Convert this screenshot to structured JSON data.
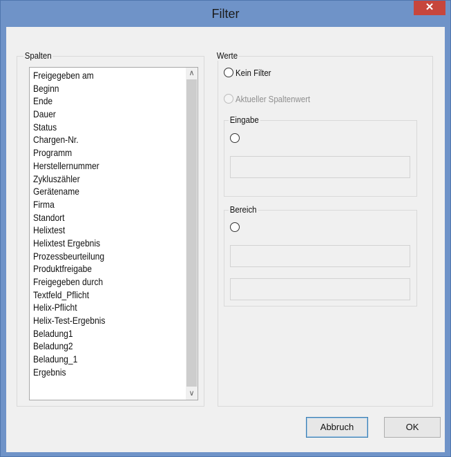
{
  "window": {
    "title": "Filter",
    "close_glyph": "✕"
  },
  "columns_group": {
    "label": "Spalten",
    "items": [
      "Freigegeben am",
      "Beginn",
      "Ende",
      "Dauer",
      "Status",
      "Chargen-Nr.",
      "Programm",
      "Herstellernummer",
      "Zykluszähler",
      "Gerätename",
      "Firma",
      "Standort",
      "Helixtest",
      "Helixtest Ergebnis",
      "Prozessbeurteilung",
      "Produktfreigabe",
      "Freigegeben durch",
      "Textfeld_Pflicht",
      "Helix-Pflicht",
      "Helix-Test-Ergebnis",
      "Beladung1",
      "Beladung2",
      "Beladung_1",
      "Ergebnis"
    ],
    "scroll_up_glyph": "∧",
    "scroll_down_glyph": "∨"
  },
  "values_group": {
    "label": "Werte",
    "no_filter_label": "Kein Filter",
    "current_value_label": "Aktueller Spaltenwert",
    "input_group": {
      "label": "Eingabe",
      "value": ""
    },
    "range_group": {
      "label": "Bereich",
      "from_value": "",
      "to_value": ""
    }
  },
  "buttons": {
    "cancel": "Abbruch",
    "ok": "OK"
  },
  "colors": {
    "window_frame": "#6f93c8",
    "close_button": "#c7463c",
    "client_bg": "#f0f0f0"
  },
  "icons": {
    "close": "close-icon",
    "scroll_up": "chevron-up-icon",
    "scroll_down": "chevron-down-icon"
  }
}
